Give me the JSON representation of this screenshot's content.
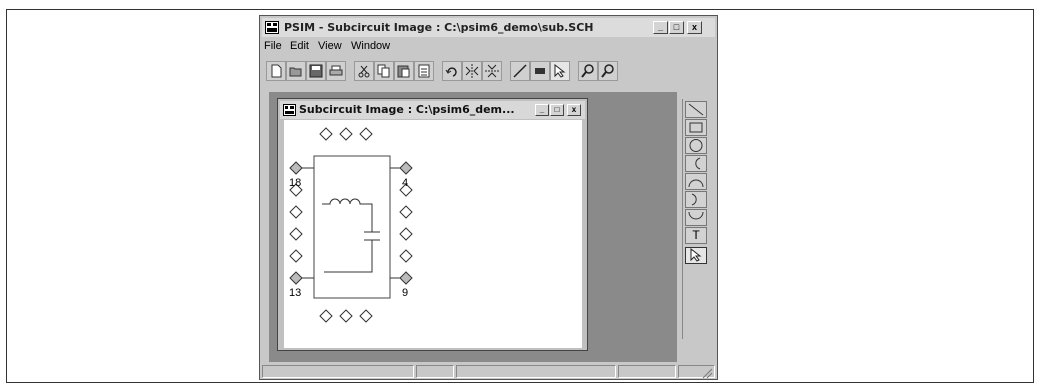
{
  "window": {
    "title": "PSIM - Subcircuit Image : C:\\psim6_demo\\sub.SCH",
    "minimize": "_",
    "maximize": "□",
    "close": "x"
  },
  "menu": [
    "File",
    "Edit",
    "View",
    "Window"
  ],
  "toolbar": {
    "icons": [
      "new-icon",
      "open-icon",
      "save-icon",
      "print-icon",
      "cut-icon",
      "copy-icon",
      "paste-icon",
      "paste-special-icon",
      "rotate-icon",
      "flip-lr-icon",
      "flip-tb-icon",
      "wire-icon",
      "label-icon",
      "select-icon",
      "zoom-in-icon",
      "zoom-out-icon"
    ]
  },
  "child_window": {
    "title": "Subcircuit Image : C:\\psim6_dem...",
    "minimize": "_",
    "maximize": "□",
    "close": "x"
  },
  "pins": {
    "top_left": "18",
    "top_right": "4",
    "bottom_left": "13",
    "bottom_right": "9"
  },
  "palette": {
    "tools": [
      "line",
      "rectangle",
      "circle",
      "arc-left",
      "arc-top",
      "arc-right",
      "arc-bottom",
      "text",
      "select"
    ],
    "text_tool": "T"
  }
}
